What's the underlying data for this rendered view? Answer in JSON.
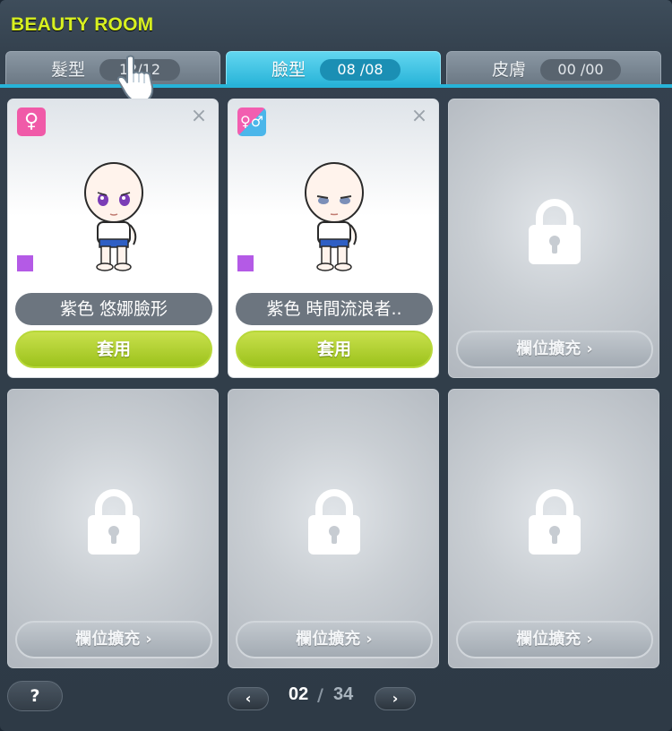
{
  "window": {
    "title": "BEAUTY ROOM"
  },
  "tabs": [
    {
      "label": "髮型",
      "count": "12/12",
      "active": false
    },
    {
      "label": "臉型",
      "count": "08 /08",
      "active": true
    },
    {
      "label": "皮膚",
      "count": "00 /00",
      "active": false
    }
  ],
  "slots": [
    {
      "type": "filled",
      "gender": "♀",
      "name": "紫色 悠娜臉形",
      "button": "套用",
      "swatch": "#b45ae6"
    },
    {
      "type": "filled",
      "gender": "♀♂",
      "name": "紫色 時間流浪者..",
      "button": "套用",
      "swatch": "#b45ae6"
    },
    {
      "type": "locked",
      "button": "欄位擴充"
    },
    {
      "type": "locked",
      "button": "欄位擴充"
    },
    {
      "type": "locked",
      "button": "欄位擴充"
    },
    {
      "type": "locked",
      "button": "欄位擴充"
    }
  ],
  "pagination": {
    "current": "02",
    "separator": "/",
    "total": "34"
  },
  "help": {
    "label": "?"
  },
  "icons": {
    "close": "close-icon",
    "lock": "lock-icon",
    "prev": "chevron-left-icon",
    "next": "chevron-right-icon",
    "cursor": "hand-cursor-icon"
  },
  "colors": {
    "accent": "#27b3d8",
    "title": "#d8f020",
    "apply": "#9cc21c"
  }
}
